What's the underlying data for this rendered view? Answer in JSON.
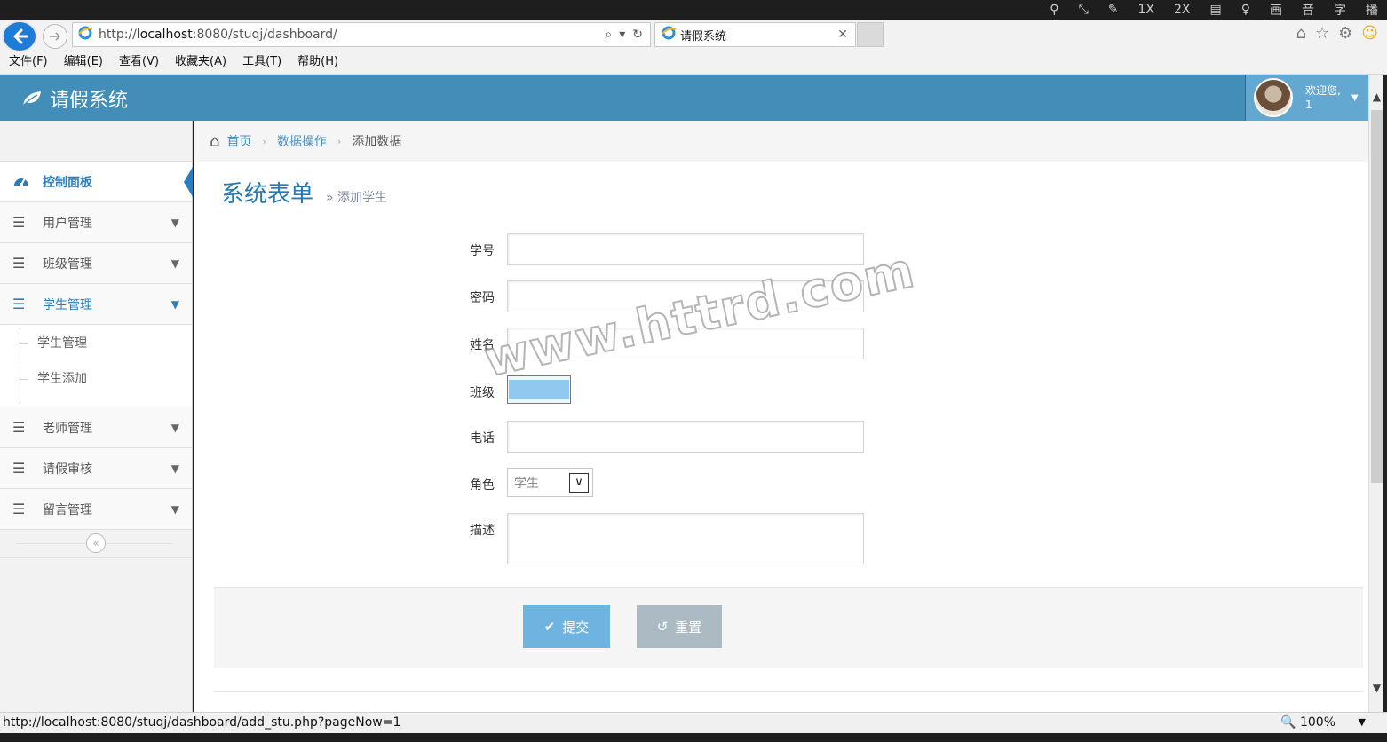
{
  "player_bar": {
    "items": [
      "⚲",
      "⤡",
      "✎",
      "1X",
      "2X",
      "▤",
      "♀",
      "画",
      "音",
      "字",
      "播"
    ]
  },
  "browser": {
    "url_prefix": "http://",
    "url_host": "localhost",
    "url_rest": ":8080/stuqj/dashboard/",
    "tab_title": "请假系统",
    "menu": [
      "文件(F)",
      "编辑(E)",
      "查看(V)",
      "收藏夹(A)",
      "工具(T)",
      "帮助(H)"
    ],
    "status_url": "http://localhost:8080/stuqj/dashboard/add_stu.php?pageNow=1",
    "zoom": "100%"
  },
  "header": {
    "brand": "请假系统",
    "welcome": "欢迎您,",
    "username": "1"
  },
  "sidebar": {
    "items": [
      {
        "label": "控制面板",
        "icon": "dashboard-icon"
      },
      {
        "label": "用户管理",
        "icon": "list-icon"
      },
      {
        "label": "班级管理",
        "icon": "list-icon"
      },
      {
        "label": "学生管理",
        "icon": "list-icon"
      },
      {
        "label": "老师管理",
        "icon": "list-icon"
      },
      {
        "label": "请假审核",
        "icon": "list-icon"
      },
      {
        "label": "留言管理",
        "icon": "list-icon"
      }
    ],
    "submenu": [
      "学生管理",
      "学生添加"
    ]
  },
  "breadcrumb": {
    "home": "首页",
    "section": "数据操作",
    "current": "添加数据"
  },
  "page": {
    "title": "系统表单",
    "subtitle": "» 添加学生"
  },
  "form": {
    "labels": {
      "student_id": "学号",
      "password": "密码",
      "name": "姓名",
      "class": "班级",
      "phone": "电话",
      "role": "角色",
      "description": "描述"
    },
    "role_value": "学生",
    "submit_label": "提交",
    "reset_label": "重置"
  },
  "watermark": "www.httrd.com",
  "colors": {
    "header": "#438eb9",
    "accent": "#2b7dbc",
    "submit": "#6fb3e0",
    "reset": "#abbac3"
  }
}
